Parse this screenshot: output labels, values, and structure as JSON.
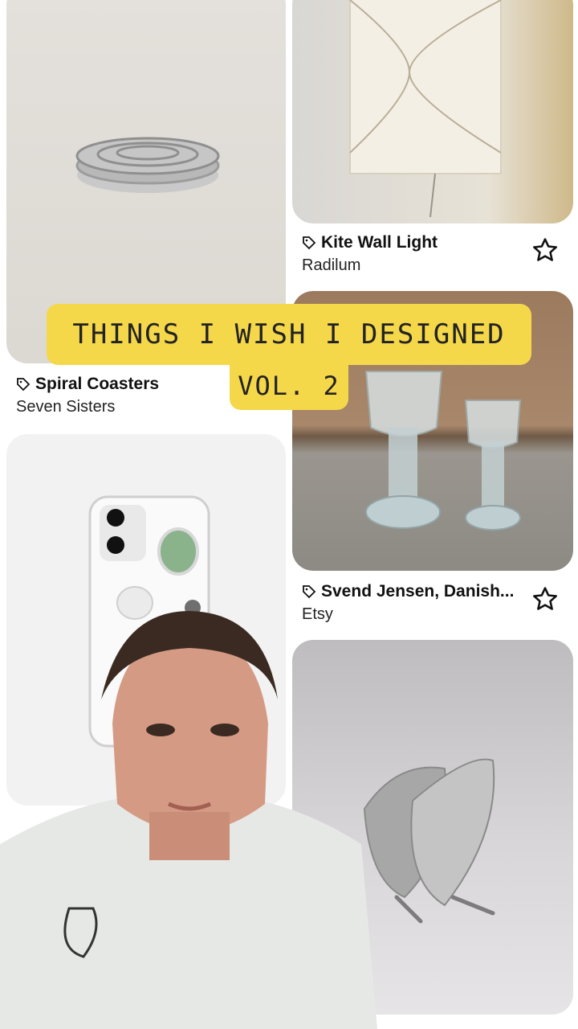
{
  "overlay": {
    "title_line1": "THINGS I WISH I DESIGNED",
    "title_line2": "VOL. 2"
  },
  "pins": [
    {
      "title": "Spiral Coasters",
      "source": "Seven Sisters"
    },
    {
      "title": "Kite Wall Light",
      "source": "Radilum"
    },
    {
      "title": "Svend Jensen, Danish...",
      "source": "Etsy"
    }
  ],
  "icons": {
    "tag": "tag-icon",
    "save": "star-icon"
  },
  "colors": {
    "banner": "#f5d84a",
    "background": "#ffffff"
  }
}
